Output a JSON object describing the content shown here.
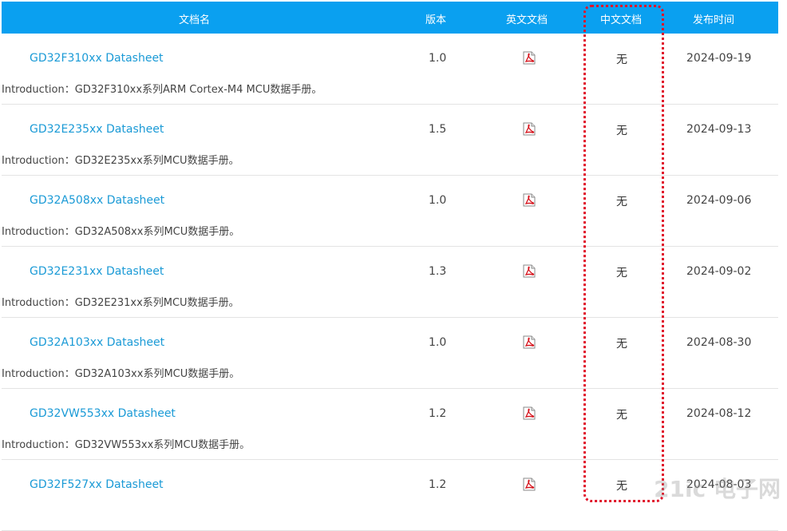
{
  "header": {
    "name": "文档名",
    "version": "版本",
    "english_doc": "英文文档",
    "chinese_doc": "中文文档",
    "release_date": "发布时间"
  },
  "rows": [
    {
      "title": "GD32F310xx Datasheet",
      "intro": "Introduction：GD32F310xx系列ARM Cortex-M4 MCU数据手册。",
      "version": "1.0",
      "chinese": "无",
      "date": "2024-09-19"
    },
    {
      "title": "GD32E235xx Datasheet",
      "intro": "Introduction：GD32E235xx系列MCU数据手册。",
      "version": "1.5",
      "chinese": "无",
      "date": "2024-09-13"
    },
    {
      "title": "GD32A508xx Datasheet",
      "intro": "Introduction：GD32A508xx系列MCU数据手册。",
      "version": "1.0",
      "chinese": "无",
      "date": "2024-09-06"
    },
    {
      "title": "GD32E231xx Datasheet",
      "intro": "Introduction：GD32E231xx系列MCU数据手册。",
      "version": "1.3",
      "chinese": "无",
      "date": "2024-09-02"
    },
    {
      "title": "GD32A103xx Datasheet",
      "intro": "Introduction：GD32A103xx系列MCU数据手册。",
      "version": "1.0",
      "chinese": "无",
      "date": "2024-08-30"
    },
    {
      "title": "GD32VW553xx Datasheet",
      "intro": "Introduction：GD32VW553xx系列MCU数据手册。",
      "version": "1.2",
      "chinese": "无",
      "date": "2024-08-12"
    },
    {
      "title": "GD32F527xx Datasheet",
      "intro": "",
      "version": "1.2",
      "chinese": "无",
      "date": "2024-08-03"
    }
  ],
  "pdf_icon": "pdf-icon",
  "colors": {
    "header_bg": "#0aa0f0",
    "link": "#1a9ad6",
    "highlight": "#e0142a"
  },
  "watermark": "21ic 电子网"
}
